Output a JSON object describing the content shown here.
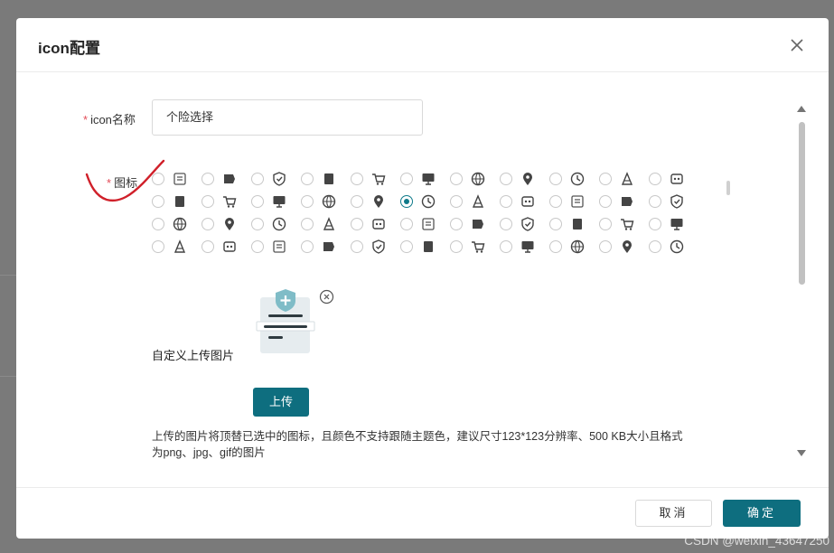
{
  "dialog": {
    "title": "icon配置",
    "close_icon": "close-icon"
  },
  "form": {
    "name_label": "icon名称",
    "name_value": "个险选择",
    "icon_label": "图标",
    "required_mark": "*",
    "upload_label": "自定义上传图片",
    "upload_button": "上传",
    "hint": "上传的图片将顶替已选中的图标，且颜色不支持跟随主题色，建议尺寸123*123分辨率、500 KB大小且格式为png、jpg、gif的图片"
  },
  "icon_grid": {
    "selected_row": 1,
    "selected_col": 5,
    "rows": [
      [
        "document-icon",
        "tag-icon",
        "shield-check-icon",
        "bookmark-icon",
        "cart-icon",
        "monitor-icon",
        "gift-icon",
        "globe-icon",
        "location-pin-icon",
        "shopping-cart-icon",
        "tree-icon"
      ],
      [
        "thumbs-up-outline-icon",
        "thumbs-up-icon",
        "card-icon",
        "headset-icon",
        "grid-icon",
        "chat-bubble-icon",
        "accessibility-icon",
        "hands-icon",
        "crown-icon",
        "clipboard-star-icon",
        "person-settings-icon"
      ],
      [
        "hand-coin-icon",
        "medical-icon",
        "tooth-icon",
        "clipboard-heart-icon",
        "screen-icon",
        "people-icon",
        "heart-pulse-icon",
        "family-icon",
        "shield-settings-icon",
        "car-icon",
        "text-logo-icon"
      ],
      [
        "id-badge-icon",
        "pills-icon",
        "beach-icon",
        "piggy-icon",
        "user-icon",
        "ticket-icon",
        "heart-hand-icon",
        "shield-user-icon",
        "user-shield-icon",
        "notebook-icon",
        "shield-doc-icon"
      ]
    ]
  },
  "footer": {
    "cancel": "取消",
    "confirm": "确定"
  },
  "watermark": "CSDN @weixin_43647250",
  "colors": {
    "primary": "#0e6e7f",
    "required": "#e34d59",
    "annotation": "#d0202a"
  }
}
